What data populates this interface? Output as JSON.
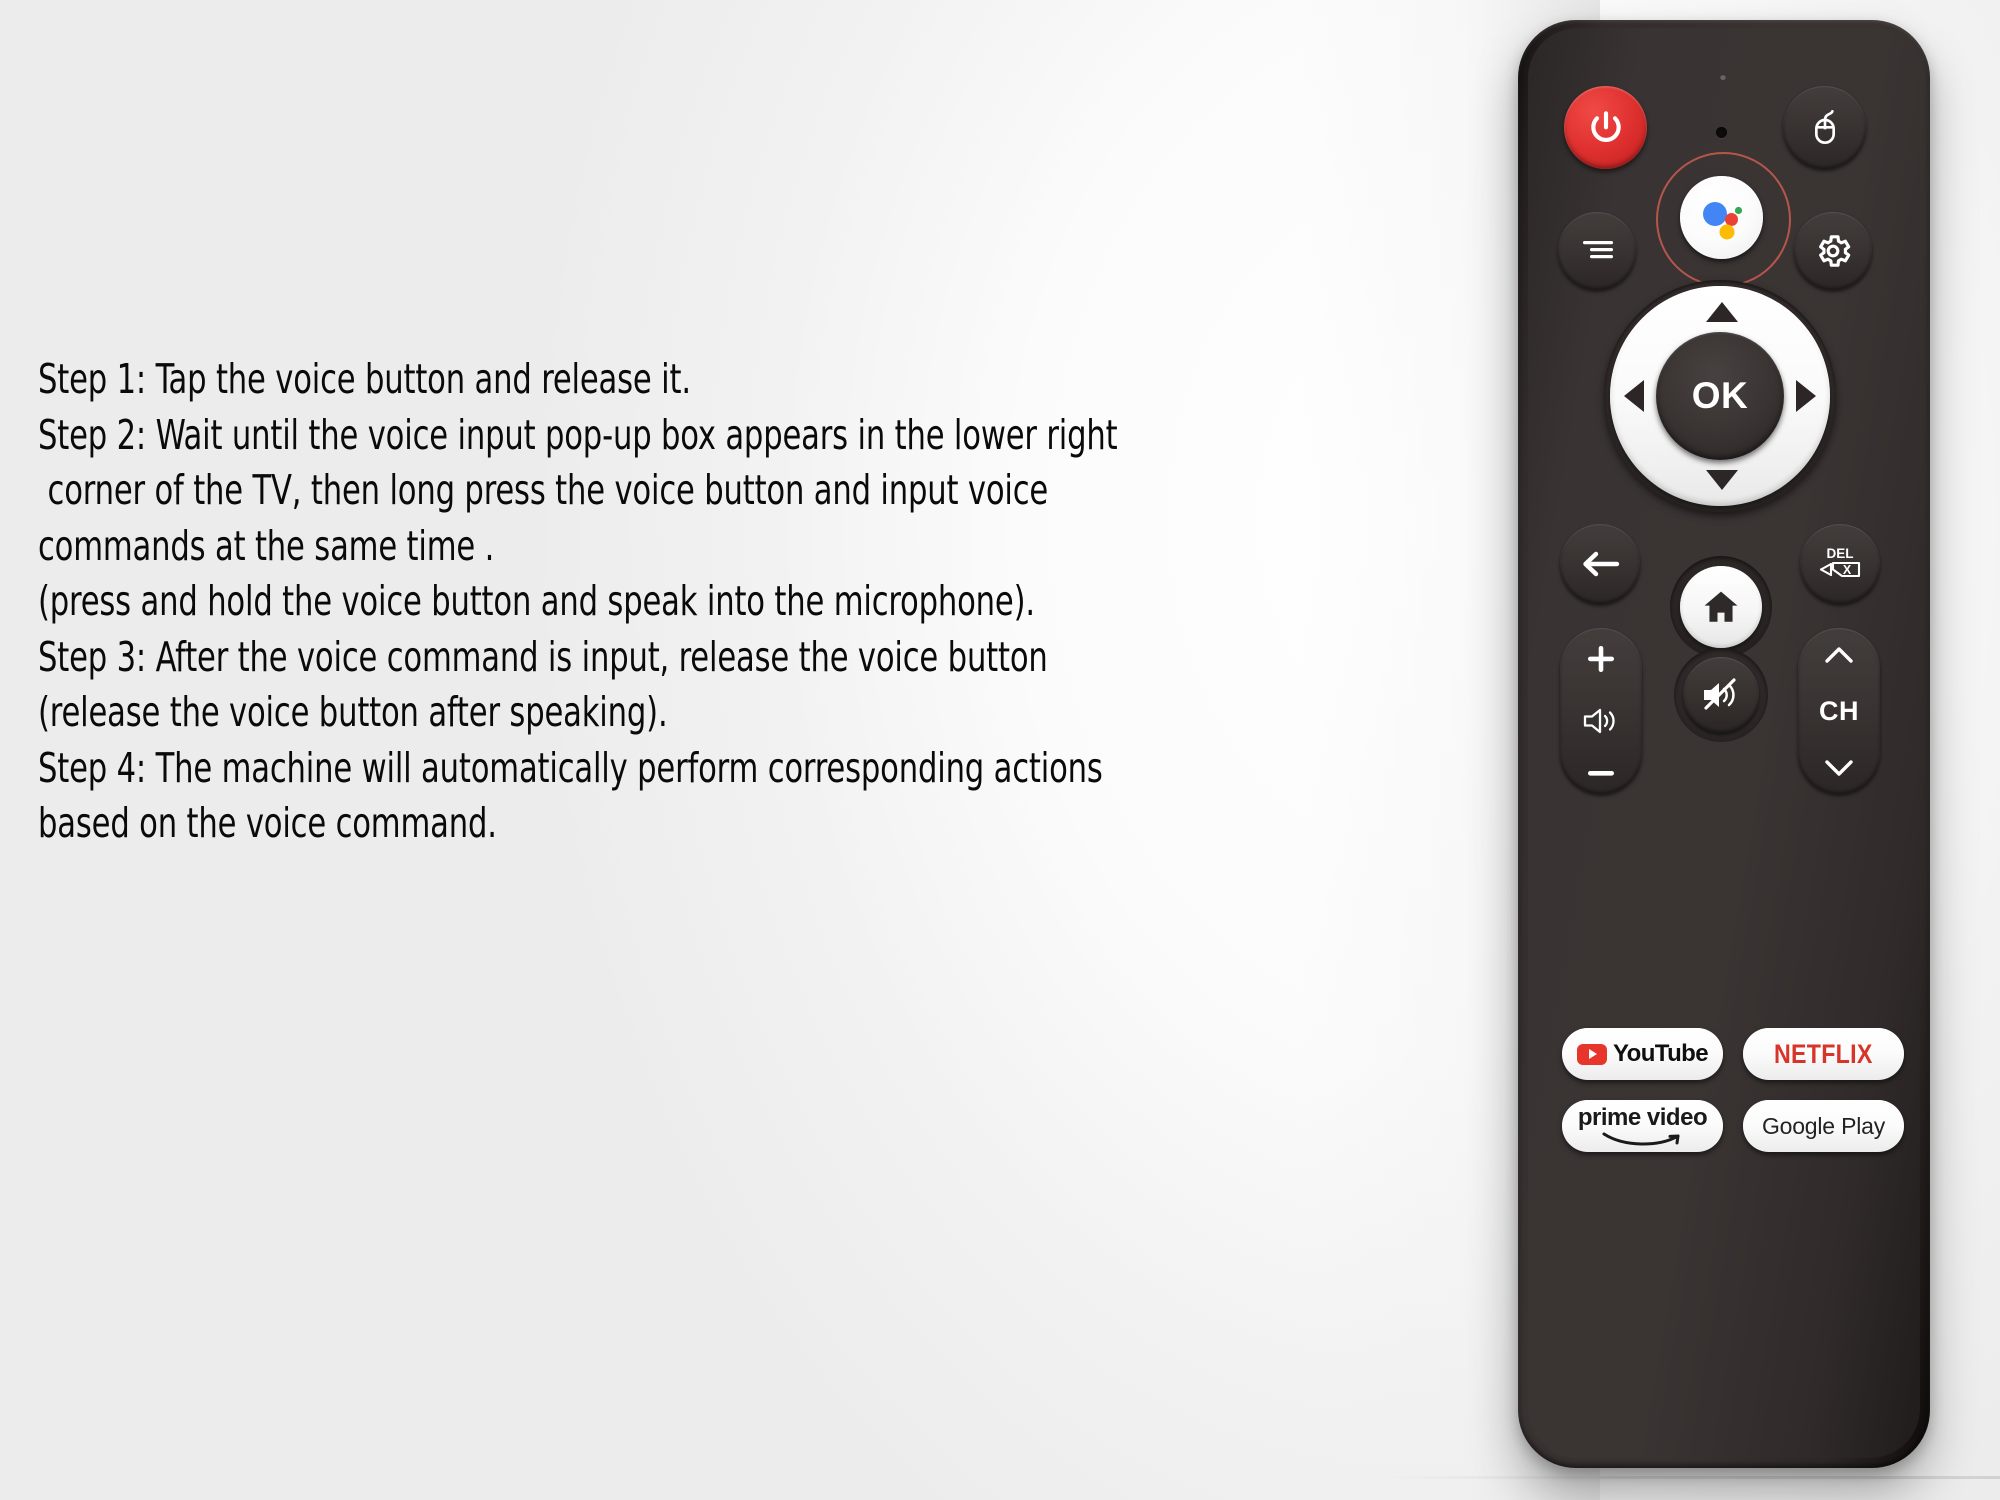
{
  "instructions": {
    "lines": [
      "Step 1: Tap the voice button and release it.",
      "Step 2: Wait until the voice input pop-up box appears in the lower right",
      " corner of the TV, then long press the voice button and input voice",
      "commands at the same time .",
      "(press and hold the voice button and speak into the microphone).",
      "Step 3: After the voice command is input, release the voice button",
      "(release the voice button after speaking).",
      "Step 4: The machine will automatically perform corresponding actions",
      "based on the voice command."
    ]
  },
  "remote": {
    "colors": {
      "body": "#383231",
      "power_red": "#e03230",
      "highlight_ring": "#b5564c",
      "white_key": "#ffffff",
      "netflix_red": "#d8352a",
      "youtube_red": "#e8352b",
      "assistant_blue": "#4285f4",
      "assistant_red": "#ea4335",
      "assistant_yellow": "#fbbc05",
      "assistant_green": "#34a853"
    },
    "keys": {
      "power": "power",
      "mouse": "mouse",
      "assistant": "google-assistant",
      "menu": "menu",
      "settings": "settings",
      "ok": "OK",
      "up": "up",
      "down": "down",
      "left": "left",
      "right": "right",
      "back": "back",
      "delete": "DEL",
      "home": "home",
      "volume_up": "+",
      "volume_icon": "volume",
      "volume_down": "−",
      "mute": "mute",
      "channel_up": "up",
      "channel_label": "CH",
      "channel_down": "down"
    },
    "apps": {
      "youtube": "YouTube",
      "netflix": "NETFLIX",
      "prime": "prime video",
      "googleplay": "Google Play"
    }
  }
}
